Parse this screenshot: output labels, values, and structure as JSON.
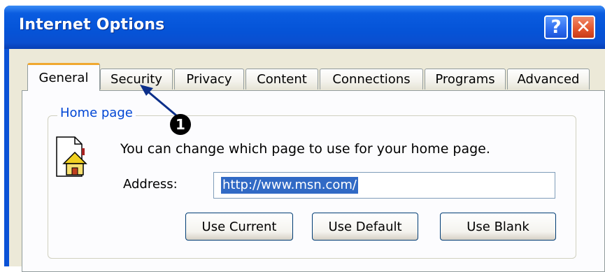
{
  "window": {
    "title": "Internet Options",
    "help_label": "?",
    "close_label": "✕"
  },
  "tabs": [
    {
      "label": "General",
      "active": true
    },
    {
      "label": "Security",
      "active": false
    },
    {
      "label": "Privacy",
      "active": false
    },
    {
      "label": "Content",
      "active": false
    },
    {
      "label": "Connections",
      "active": false
    },
    {
      "label": "Programs",
      "active": false
    },
    {
      "label": "Advanced",
      "active": false
    }
  ],
  "home_page": {
    "group_label": "Home page",
    "icon": "home-page-icon",
    "description": "You can change which page to use for your home page.",
    "address_label": "Address:",
    "address_value": "http://www.msn.com/",
    "buttons": {
      "use_current": "Use Current",
      "use_default": "Use Default",
      "use_blank": "Use Blank"
    }
  },
  "annotation": {
    "callout_number": "1"
  },
  "colors": {
    "titlebar": "#0554d8",
    "dialog_bg": "#ece9d8",
    "group_title": "#0046d5",
    "selection": "#316ac5",
    "close_button": "#e2542c"
  }
}
